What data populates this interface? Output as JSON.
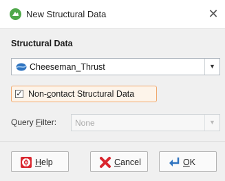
{
  "window": {
    "title": "New Structural Data",
    "close_glyph": "✕"
  },
  "section": {
    "title": "Structural Data"
  },
  "structural_select": {
    "value": "Cheeseman_Thrust",
    "icon": "structural-data-icon",
    "arrow": "▼"
  },
  "noncontact": {
    "checked": true,
    "check_glyph": "✓",
    "label": "Non-contact Structural Data"
  },
  "query_filter": {
    "label": "Query Filter:",
    "value": "None",
    "arrow": "▼",
    "enabled": false
  },
  "buttons": {
    "help": {
      "label": "Help",
      "icon": "lifebuoy-icon"
    },
    "cancel": {
      "label": "Cancel",
      "icon": "cancel-x-icon"
    },
    "ok": {
      "label": "OK",
      "icon": "ok-arrow-icon"
    }
  },
  "colors": {
    "accent_orange": "#f0a86d",
    "icon_blue": "#2f74c0",
    "icon_green": "#4fa84a",
    "cancel_red": "#d9262e"
  }
}
